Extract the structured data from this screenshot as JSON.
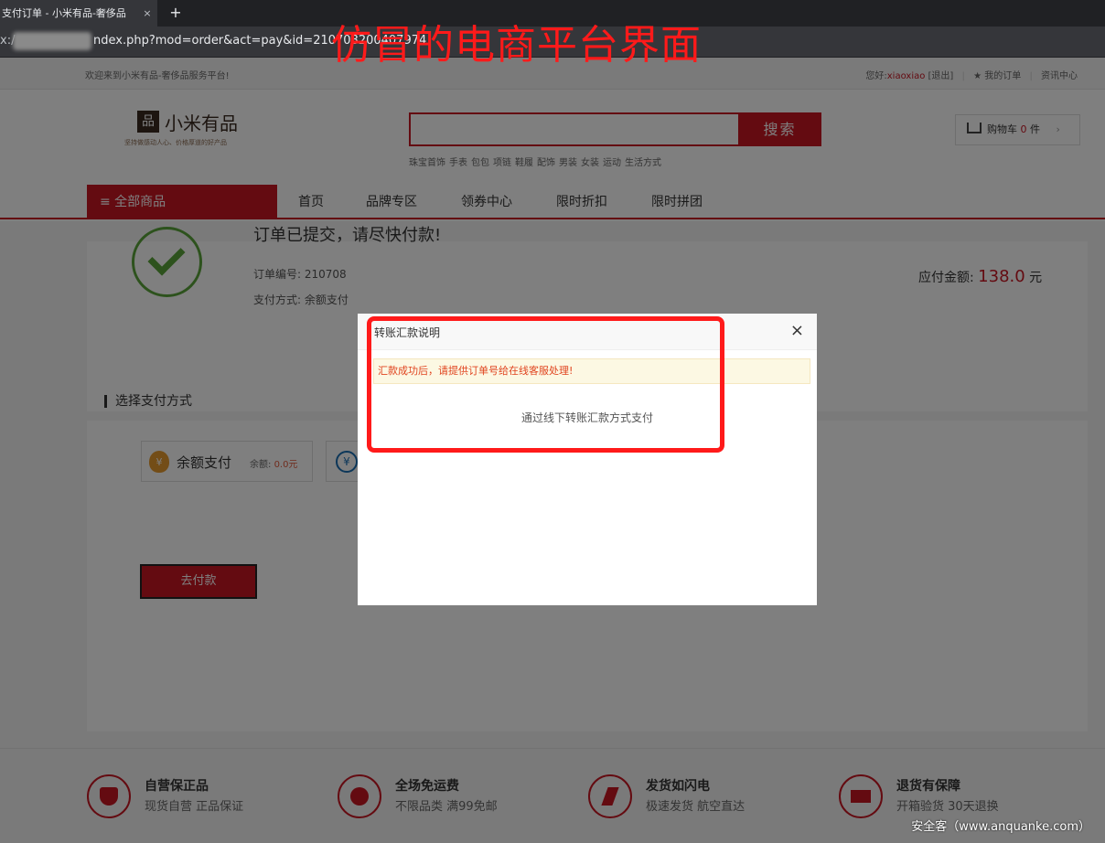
{
  "browser": {
    "tab_title": "支付订单 - 小米有品-奢侈品",
    "tab_close": "×",
    "new_tab": "+",
    "url_prefix": "x:/",
    "url": "ndex.php?mod=order&act=pay&id=210708200407974"
  },
  "header": {
    "welcome": "欢迎来到小米有品-奢侈品服务平台!",
    "greeting": "您好:",
    "username": "xiaoxiao",
    "logout": "[退出]",
    "my_orders": "★ 我的订单",
    "info_center": "资讯中心"
  },
  "annotation": "仿冒的电商平台界面",
  "logo": {
    "icon": "品",
    "name": "小米有品",
    "slogan": "坚持做感动人心、价格厚道的好产品"
  },
  "search": {
    "button": "搜索",
    "hotwords": [
      "珠宝首饰",
      "手表",
      "包包",
      "项链",
      "鞋履",
      "配饰",
      "男装",
      "女装",
      "运动",
      "生活方式"
    ]
  },
  "cart": {
    "label": "购物车",
    "count": "0",
    "unit": "件",
    "arrow": "›"
  },
  "nav": {
    "all_categories": "≡ 全部商品",
    "items": [
      "首页",
      "品牌专区",
      "领券中心",
      "限时折扣",
      "限时拼团"
    ]
  },
  "order": {
    "title": "订单已提交，请尽快付款!",
    "order_no_label": "订单编号:",
    "order_no": "210708",
    "pay_method_label": "支付方式:",
    "pay_method_value": "余额支付",
    "amount_label": "应付金额:",
    "amount": "138.0",
    "amount_unit": "元"
  },
  "payment": {
    "section_title": "选择支付方式",
    "balance_icon": "¥",
    "balance_label": "余额支付",
    "balance_sub_label": "余额:",
    "balance_value": "0.0元",
    "other_icon": "¥",
    "go_pay": "去付款"
  },
  "modal": {
    "title": "转账汇款说明",
    "close": "×",
    "notice": "汇款成功后，请提供订单号给在线客服处理!",
    "body": "通过线下转账汇款方式支付"
  },
  "footer": {
    "features": [
      {
        "icon": "shield-icon",
        "title": "自营保正品",
        "sub": "现货自营 正品保证"
      },
      {
        "icon": "heart-hands-icon",
        "title": "全场免运费",
        "sub": "不限品类 满99免邮"
      },
      {
        "icon": "lightning-icon",
        "title": "发货如闪电",
        "sub": "极速发货 航空直达"
      },
      {
        "icon": "truck-icon",
        "title": "退货有保障",
        "sub": "开箱验货 30天退换"
      }
    ],
    "watermark": "安全客（www.anquanke.com）"
  },
  "colors": {
    "brand_red": "#c81623",
    "highlight_red": "#ff1a1a",
    "success_green": "#5aa53a"
  }
}
